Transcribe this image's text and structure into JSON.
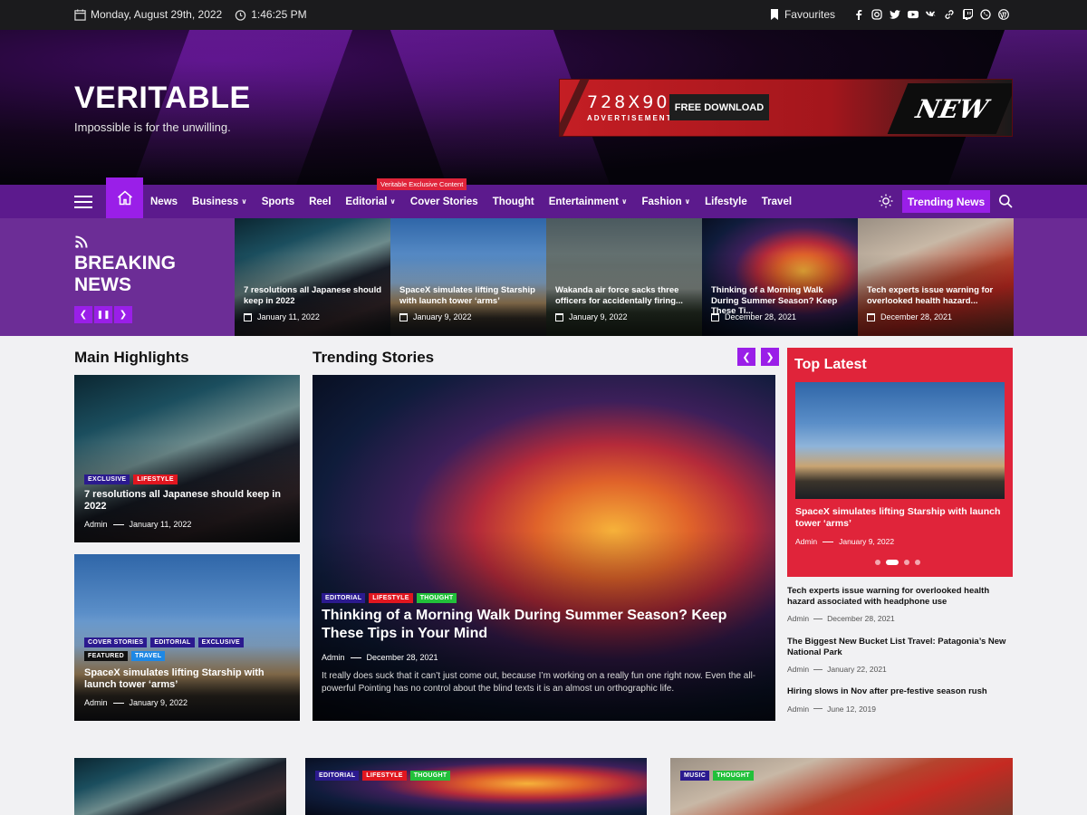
{
  "topbar": {
    "date": "Monday, August 29th, 2022",
    "time": "1:46:25 PM",
    "favourites": "Favourites",
    "social": [
      "facebook-icon",
      "instagram-icon",
      "twitter-icon",
      "youtube-icon",
      "vk-icon",
      "link-icon",
      "twitch-icon",
      "whatsapp-icon",
      "wordpress-icon"
    ]
  },
  "header": {
    "logo": "VERITABLE",
    "tagline": "Impossible is for the unwilling.",
    "ad": {
      "size": "728X90",
      "label": "ADVERTISEMENT",
      "button": "FREE DOWNLOAD",
      "brand": "NEW"
    }
  },
  "nav": {
    "items": [
      {
        "label": "News",
        "caret": false
      },
      {
        "label": "Business",
        "caret": true
      },
      {
        "label": "Sports",
        "caret": false
      },
      {
        "label": "Reel",
        "caret": false
      },
      {
        "label": "Editorial",
        "caret": true
      },
      {
        "label": "Cover Stories",
        "caret": false
      },
      {
        "label": "Thought",
        "caret": false
      },
      {
        "label": "Entertainment",
        "caret": true
      },
      {
        "label": "Fashion",
        "caret": true
      },
      {
        "label": "Lifestyle",
        "caret": false
      },
      {
        "label": "Travel",
        "caret": false
      }
    ],
    "badge": "Veritable Exclusive Content",
    "trending_button": "Trending News"
  },
  "breaking": {
    "title_line1": "BREAKING",
    "title_line2": "NEWS",
    "cards": [
      {
        "title": "7 resolutions all Japanese should keep in 2022",
        "date": "January 11, 2022",
        "img": "city"
      },
      {
        "title": "SpaceX simulates lifting Starship with launch tower ‘arms’",
        "date": "January 9, 2022",
        "img": "rocket"
      },
      {
        "title": "Wakanda air force sacks three officers for accidentally firing...",
        "date": "January 9, 2022",
        "img": "plane"
      },
      {
        "title": "Thinking of a Morning Walk During Summer Season? Keep These Ti...",
        "date": "December 28, 2021",
        "img": "balloon"
      },
      {
        "title": "Tech experts issue warning for overlooked health hazard...",
        "date": "December 28, 2021",
        "img": "man"
      }
    ]
  },
  "main_highlights": {
    "heading": "Main Highlights",
    "items": [
      {
        "tags": [
          "EXCLUSIVE",
          "LIFESTYLE"
        ],
        "title": "7 resolutions all Japanese should keep in 2022",
        "author": "Admin",
        "date": "January 11, 2022"
      },
      {
        "tags": [
          "COVER STORIES",
          "EDITORIAL",
          "EXCLUSIVE",
          "FEATURED",
          "TRAVEL"
        ],
        "title": "SpaceX simulates lifting Starship with launch tower ‘arms’",
        "author": "Admin",
        "date": "January 9, 2022"
      }
    ]
  },
  "trending": {
    "heading": "Trending Stories",
    "tags": [
      "EDITORIAL",
      "LIFESTYLE",
      "THOUGHT"
    ],
    "title": "Thinking of a Morning Walk During Summer Season? Keep These Tips in Your Mind",
    "author": "Admin",
    "date": "December 28, 2021",
    "excerpt": "It really does suck that it can’t just come out, because I’m working on a really fun one right now. Even the all-powerful Pointing has no control about the blind texts it is an almost un orthographic life."
  },
  "top_latest": {
    "heading": "Top Latest",
    "featured": {
      "title": "SpaceX simulates lifting Starship with launch tower ‘arms’",
      "author": "Admin",
      "date": "January 9, 2022"
    },
    "slide_dots": 4,
    "active_dot": 2,
    "items": [
      {
        "title": "Tech experts issue warning for overlooked health hazard associated with headphone use",
        "author": "Admin",
        "date": "December 28, 2021"
      },
      {
        "title": "The Biggest New Bucket List Travel: Patagonia’s New National Park",
        "author": "Admin",
        "date": "January 22, 2021"
      },
      {
        "title": "Hiring slows in Nov after pre-festive season rush",
        "author": "Admin",
        "date": "June 12, 2019"
      }
    ]
  },
  "bottom": {
    "card2_tags": [
      "EDITORIAL",
      "LIFESTYLE",
      "THOUGHT"
    ],
    "card3_tags": [
      "MUSIC",
      "THOUGHT"
    ]
  },
  "colors": {
    "accent": "#9a1fe8",
    "nav": "#5c1a8d",
    "red": "#e0243a",
    "tag_exclusive": "#2b1a8f",
    "tag_lifestyle": "#e0161f",
    "tag_thought": "#22c03a",
    "tag_featured": "#111111",
    "tag_travel": "#1e88e5",
    "tag_editorial": "#2b1a8f",
    "tag_cover": "#2b1a8f",
    "tag_music": "#2b1a8f"
  }
}
